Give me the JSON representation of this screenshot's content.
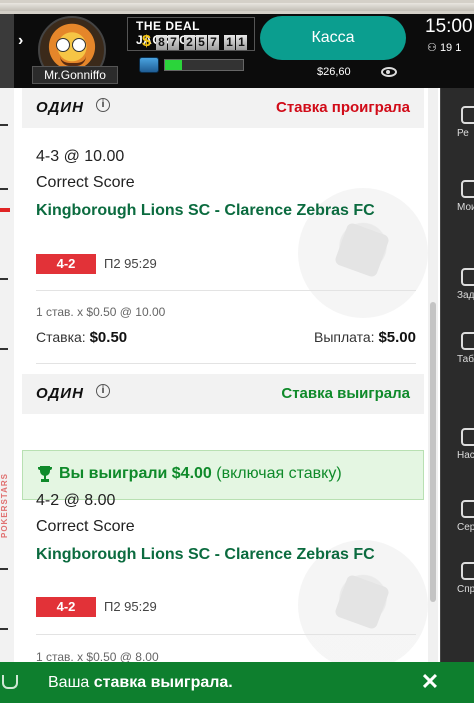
{
  "header": {
    "username": "Mr.Gonniffo",
    "jackpot_title": "THE DEAL JACKPOT",
    "jackpot_currency": "$",
    "jackpot_digits": [
      "8",
      "7",
      "2",
      "5",
      "7",
      "1",
      "1"
    ],
    "rewards_progress_fraction": 0.22,
    "cashier_label": "Касса",
    "balance": "$26,60",
    "time": "15:00",
    "players_count": "19 1"
  },
  "sidebar": {
    "items": [
      {
        "icon": "rewards-icon",
        "label": "Ре"
      },
      {
        "icon": "star-icon",
        "label": "Мои награ"
      },
      {
        "icon": "alarm-icon",
        "label": "Зад"
      },
      {
        "icon": "table-icon",
        "label": "Табл лидер"
      },
      {
        "icon": "gear-icon",
        "label": "Наст"
      },
      {
        "icon": "service-icon",
        "label": "Серв"
      },
      {
        "icon": "help-icon",
        "label": "Спр"
      }
    ]
  },
  "left_strip": {
    "brand_text": "POKERSTARS"
  },
  "bets": [
    {
      "type": "ОДИН",
      "info": "i",
      "status": "Ставка проиграла",
      "status_kind": "lost",
      "odds_line": "4-3 @ 10.00",
      "market": "Correct Score",
      "event": "Kingborough Lions SC - Clarence Zebras FC",
      "score": "4-2",
      "score_time": "П2 95:29",
      "summary": "1 став. x $0.50 @ 10.00",
      "stake_label": "Ставка:",
      "stake_value": "$0.50",
      "payout_label": "Выплата:",
      "payout_value": "$5.00"
    },
    {
      "type": "ОДИН",
      "info": "i",
      "status": "Ставка выиграла",
      "status_kind": "won",
      "won_text": "Вы выиграли $4.00",
      "won_suffix": "(включая ставку)",
      "odds_line": "4-2 @ 8.00",
      "market": "Correct Score",
      "event": "Kingborough Lions SC - Clarence Zebras FC",
      "score": "4-2",
      "score_time": "П2 95:29",
      "summary": "1 став. x $0.50 @ 8.00"
    }
  ],
  "toast": {
    "message_plain": "Ваша ",
    "message_bold": "ставка выиграла.",
    "close": "✕"
  },
  "colors": {
    "accent_teal": "#0b9e8f",
    "event_green": "#0b6b3f",
    "lost_red": "#d10b18",
    "won_green": "#0f8a2a",
    "score_red": "#e23238",
    "toast_green": "#0e7f2e"
  }
}
